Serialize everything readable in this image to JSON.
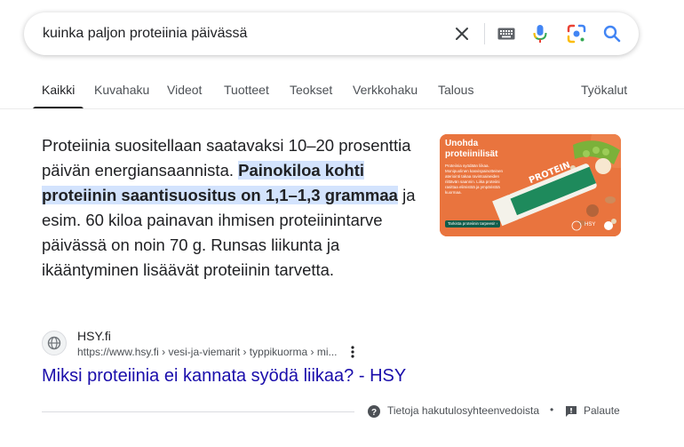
{
  "search": {
    "query": "kuinka paljon proteiinia päivässä",
    "icons": [
      "clear-icon",
      "keyboard-icon",
      "microphone-icon",
      "lens-icon",
      "search-icon"
    ]
  },
  "tabs": [
    {
      "label": "Kaikki",
      "active": true
    },
    {
      "label": "Kuvahaku"
    },
    {
      "label": "Videot"
    },
    {
      "label": "Tuotteet"
    },
    {
      "label": "Teokset"
    },
    {
      "label": "Verkkohaku"
    },
    {
      "label": "Talous"
    }
  ],
  "tools_label": "Työkalut",
  "snippet": {
    "before": "Proteiinia suositellaan saatavaksi 10–20 prosenttia päivän energiansaannista. ",
    "highlight": "Painokiloa kohti proteiinin saantisuositus on 1,1–1,3 grammaa",
    "after": " ja esim. 60 kiloa painavan ihmisen proteiinintarve päivässä on noin 70 g. Runsas liikunta ja ikääntyminen lisäävät proteiinin tarvetta."
  },
  "thumbnail": {
    "title_line1": "Unohda",
    "title_line2": "proteiinilisät",
    "body": "Proteiinia syödään liikaa. Monipuolinen kasvispainotteinen ateriointi takaa ravintoaineiden riittävän saannin. Liika proteiini rasittaa elimistöä ja ympäristöä kuormaa.",
    "button": "Tarkista proteiinin tarpeesi! ›",
    "bar_text": "PROTEIN",
    "logo": "HSY",
    "colors": {
      "background": "#e9743e",
      "bar": "#f4f2ea",
      "bar_band": "#1e8a5c",
      "pea": "#7bb13a"
    }
  },
  "source": {
    "site": "HSY.fi",
    "url": "https://www.hsy.fi › vesi-ja-viemarit › typpikuorma › mi..."
  },
  "result_title": "Miksi proteiinia ei kannata syödä liikaa? - HSY",
  "footer": {
    "about": "Tietoja hakutulosyhteenvedoista",
    "separator": "•",
    "feedback": "Palaute"
  },
  "colors": {
    "link": "#1a0dab",
    "highlight": "#d3e3fd",
    "search_blue": "#4285f4"
  }
}
